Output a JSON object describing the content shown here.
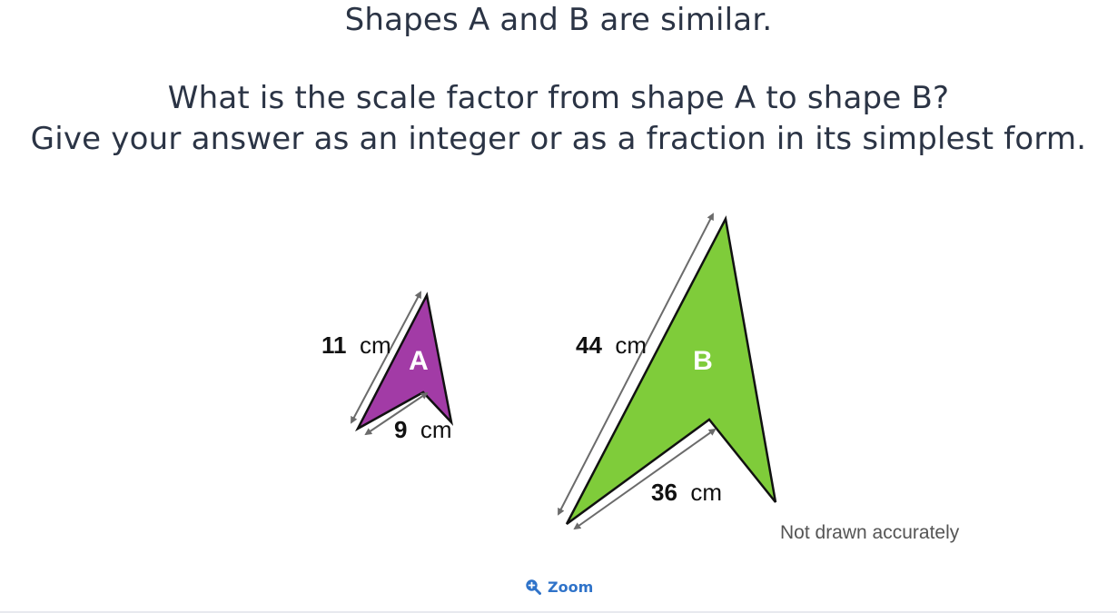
{
  "question": {
    "title": "Shapes A and B are similar.",
    "prompt": "What is the scale factor from shape A to shape B?",
    "instruction": "Give your answer as an integer or as a fraction in its simplest form."
  },
  "diagram": {
    "shape_a": {
      "letter": "A",
      "color": "#a23ba6",
      "long_side": {
        "value": "11",
        "unit": "cm"
      },
      "short_side": {
        "value": "9",
        "unit": "cm"
      }
    },
    "shape_b": {
      "letter": "B",
      "color": "#7fcc3a",
      "long_side": {
        "value": "44",
        "unit": "cm"
      },
      "short_side": {
        "value": "36",
        "unit": "cm"
      }
    },
    "note": "Not drawn accurately"
  },
  "zoom": {
    "label": "Zoom",
    "icon": "magnifier-plus-icon",
    "color": "#2f73c9"
  }
}
